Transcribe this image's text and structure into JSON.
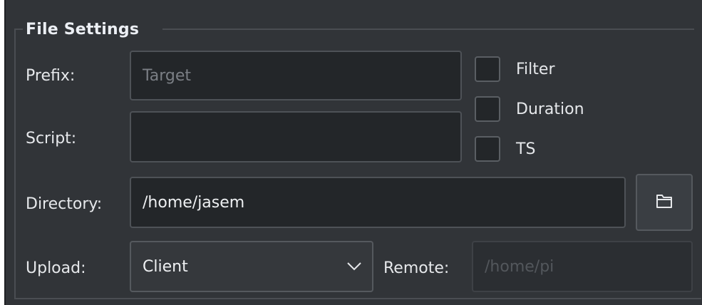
{
  "group": {
    "title": "File Settings"
  },
  "labels": {
    "prefix": "Prefix:",
    "script": "Script:",
    "directory": "Directory:",
    "upload": "Upload:",
    "remote": "Remote:"
  },
  "fields": {
    "prefix_placeholder": "Target",
    "script_value": "",
    "directory_value": "/home/jasem",
    "remote_placeholder": "/home/pi"
  },
  "checkboxes": [
    {
      "label": "Filter",
      "checked": false
    },
    {
      "label": "Duration",
      "checked": false
    },
    {
      "label": "TS",
      "checked": false
    }
  ],
  "upload": {
    "selected": "Client"
  },
  "icons": {
    "browse": "folder-icon",
    "dropdown": "chevron-down-icon"
  },
  "colors": {
    "background": "#313438",
    "field_background": "#232629",
    "border": "#4e5257",
    "text": "#e6e8eb",
    "placeholder": "#7b7f85"
  }
}
